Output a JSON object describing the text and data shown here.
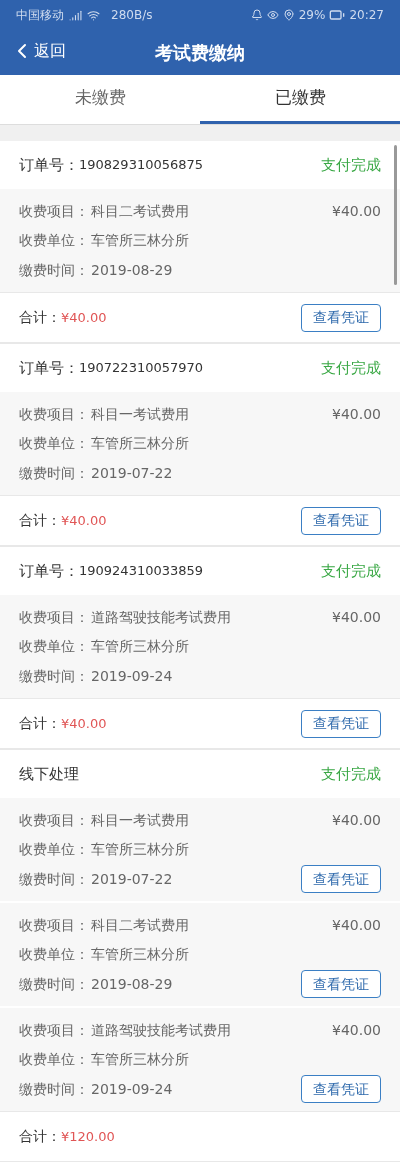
{
  "status_bar": {
    "carrier": "中国移动",
    "speed": "280B/s",
    "battery": "29%",
    "time": "20:27"
  },
  "header": {
    "back": "返回",
    "title": "考试费缴纳"
  },
  "tabs": [
    {
      "label": "未缴费",
      "selected": false
    },
    {
      "label": "已缴费",
      "selected": true
    }
  ],
  "orders": [
    {
      "kind": "order",
      "order_label": "订单号：",
      "order_no": "190829310056875",
      "status": "支付完成",
      "items": [
        {
          "fields": [
            {
              "label": "收费项目：",
              "value": "科目二考试费用"
            },
            {
              "label": "收费单位：",
              "value": "车管所三林分所"
            },
            {
              "label": "缴费时间：",
              "value": "2019-08-29"
            }
          ],
          "amount": "¥40.00"
        }
      ],
      "total_label": "合计：",
      "total": "¥40.00",
      "button": "查看凭证"
    },
    {
      "kind": "order",
      "order_label": "订单号：",
      "order_no": "190722310057970",
      "status": "支付完成",
      "items": [
        {
          "fields": [
            {
              "label": "收费项目：",
              "value": "科目一考试费用"
            },
            {
              "label": "收费单位：",
              "value": "车管所三林分所"
            },
            {
              "label": "缴费时间：",
              "value": "2019-07-22"
            }
          ],
          "amount": "¥40.00"
        }
      ],
      "total_label": "合计：",
      "total": "¥40.00",
      "button": "查看凭证"
    },
    {
      "kind": "order",
      "order_label": "订单号：",
      "order_no": "190924310033859",
      "status": "支付完成",
      "items": [
        {
          "fields": [
            {
              "label": "收费项目：",
              "value": "道路驾驶技能考试费用"
            },
            {
              "label": "收费单位：",
              "value": "车管所三林分所"
            },
            {
              "label": "缴费时间：",
              "value": "2019-09-24"
            }
          ],
          "amount": "¥40.00"
        }
      ],
      "total_label": "合计：",
      "total": "¥40.00",
      "button": "查看凭证"
    },
    {
      "kind": "offline",
      "title": "线下处理",
      "status": "支付完成",
      "items": [
        {
          "fields": [
            {
              "label": "收费项目：",
              "value": "科目一考试费用"
            },
            {
              "label": "收费单位：",
              "value": "车管所三林分所"
            },
            {
              "label": "缴费时间：",
              "value": "2019-07-22"
            }
          ],
          "amount": "¥40.00",
          "button": "查看凭证"
        },
        {
          "fields": [
            {
              "label": "收费项目：",
              "value": "科目二考试费用"
            },
            {
              "label": "收费单位：",
              "value": "车管所三林分所"
            },
            {
              "label": "缴费时间：",
              "value": "2019-08-29"
            }
          ],
          "amount": "¥40.00",
          "button": "查看凭证"
        },
        {
          "fields": [
            {
              "label": "收费项目：",
              "value": "道路驾驶技能考试费用"
            },
            {
              "label": "收费单位：",
              "value": "车管所三林分所"
            },
            {
              "label": "缴费时间：",
              "value": "2019-09-24"
            }
          ],
          "amount": "¥40.00",
          "button": "查看凭证"
        }
      ],
      "total_label": "合计：",
      "total": "¥120.00"
    }
  ]
}
